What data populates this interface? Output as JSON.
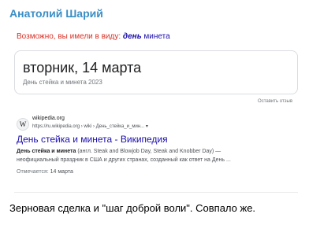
{
  "sender": "Анатолий Шарий",
  "search": {
    "suggest_prefix": "Возможно, вы имели в виду: ",
    "suggest_query_bold": "день",
    "suggest_query_rest": " минета",
    "card_title": "вторник, 14 марта",
    "card_subtitle": "День стейка и минета 2023",
    "feedback": "Оставить отзыв",
    "result": {
      "favicon": "W",
      "site": "wikipedia.org",
      "url": "https://ru.wikipedia.org › wiki › День_стейка_и_мин...  ▾",
      "title": "День стейка и минета - Википедия",
      "snippet_line1_bold": "День стейка и минета",
      "snippet_line1_rest": " (англ. Steak and Blowjob Day, Steak and Knobber Day) —",
      "snippet_line2": "неофициальный праздник в США и других странах, созданный как ответ на День ...",
      "noted_prefix": "Отмечается: ",
      "noted_value": "14 марта"
    }
  },
  "message_text": "Зерновая сделка и \"шаг доброй воли\". Совпало же."
}
